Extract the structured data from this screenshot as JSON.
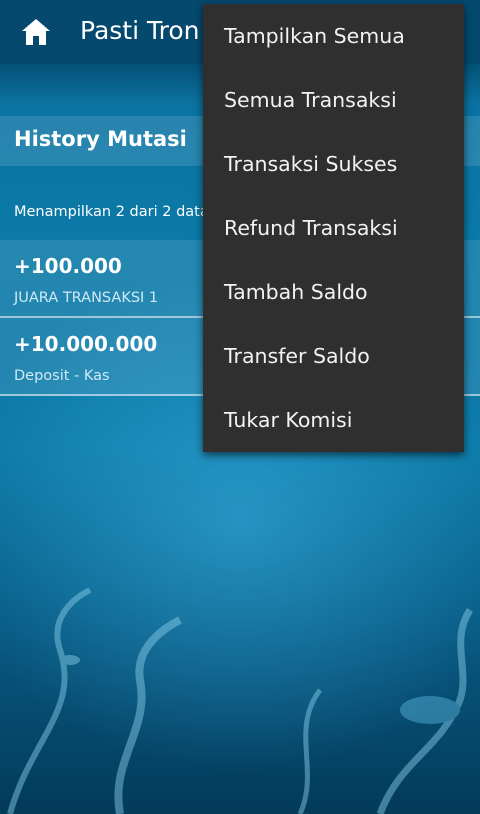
{
  "appbar": {
    "title": "Pasti Tron"
  },
  "section": {
    "title": "History Mutasi",
    "count_text": "Menampilkan 2 dari 2 data"
  },
  "transactions": [
    {
      "amount": "+100.000",
      "description": "JUARA TRANSAKSI 1"
    },
    {
      "amount": "+10.000.000",
      "description": "Deposit - Kas"
    }
  ],
  "menu": {
    "items": [
      "Tampilkan Semua",
      "Semua Transaksi",
      "Transaksi Sukses",
      "Refund Transaksi",
      "Tambah Saldo",
      "Transfer Saldo",
      "Tukar Komisi"
    ]
  },
  "colors": {
    "appbar": "#05496f",
    "menu_bg": "#2f2f2f",
    "background": "#0b78a6"
  },
  "icons": {
    "home": "home-icon"
  }
}
